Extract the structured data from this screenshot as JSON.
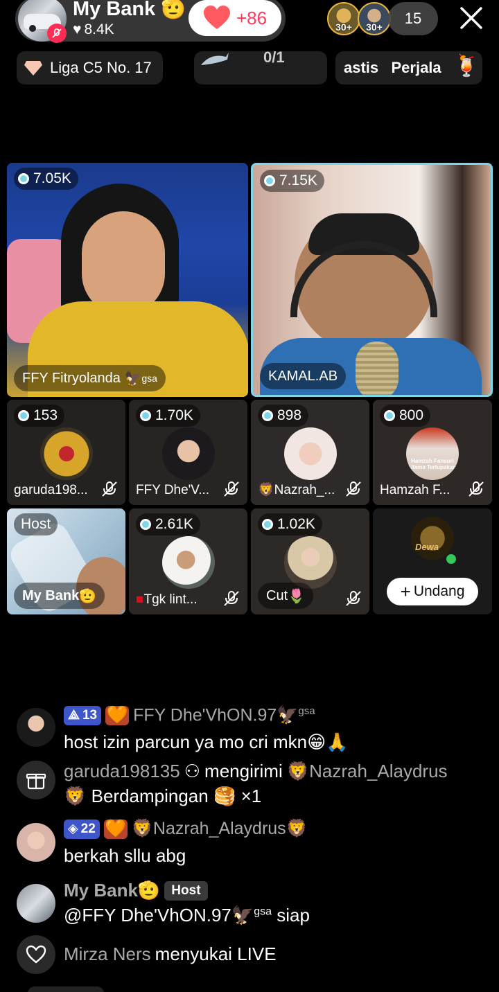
{
  "header": {
    "host_name": "My Bank",
    "host_likes": "8.4K",
    "like_delta": "+86",
    "viewer_levels": [
      "30+",
      "30+"
    ],
    "viewer_count": "15"
  },
  "subbar": {
    "league": "Liga C5 No. 17",
    "goal_progress": "0/1",
    "marquee": "astis   Perjala"
  },
  "tiles": {
    "big": [
      {
        "score": "7.05K",
        "name": "FFY Fitryolanda",
        "suffix": "gsa"
      },
      {
        "score": "7.15K",
        "name": "KAMAL.AB"
      }
    ],
    "row2": [
      {
        "score": "153",
        "name": "garuda198..."
      },
      {
        "score": "1.70K",
        "name": "FFY Dhe'V..."
      },
      {
        "score": "898",
        "name": "Nazrah_..."
      },
      {
        "score": "800",
        "name": "Hamzah F...",
        "avatar_text": "Hamzah Fansuri Ulama Terlupakan"
      }
    ],
    "row3": [
      {
        "tag": "Host",
        "name": "My Bank"
      },
      {
        "score": "2.61K",
        "name": "Tgk lint..."
      },
      {
        "score": "1.02K",
        "name": "Cut"
      },
      {
        "avatar_text": "Dewa",
        "invite_label": "Undang"
      }
    ]
  },
  "chat": [
    {
      "level": "13",
      "user": "FFY Dhe'VhON.97",
      "suffix": "gsa",
      "text": "host izin parcun ya mo cri mkn"
    },
    {
      "sender": "garuda198135",
      "action": "mengirimi",
      "recipient": "Nazrah_Alaydrus",
      "gift": "Berdampingan",
      "count": "×1"
    },
    {
      "level": "22",
      "user": "Nazrah_Alaydrus",
      "text": "berkah sllu abg"
    },
    {
      "user": "My Bank",
      "tag": "Host",
      "mention": "@FFY Dhe'VhON.97",
      "mention_suffix": "gsa",
      "text": "siap"
    },
    {
      "user": "Mirza Ners",
      "text": "menyukai LIVE"
    }
  ],
  "colors": {
    "like_red": "#ff3b5c",
    "accent_cyan": "#7fd4e8",
    "level_blue": "#3e56c9"
  }
}
